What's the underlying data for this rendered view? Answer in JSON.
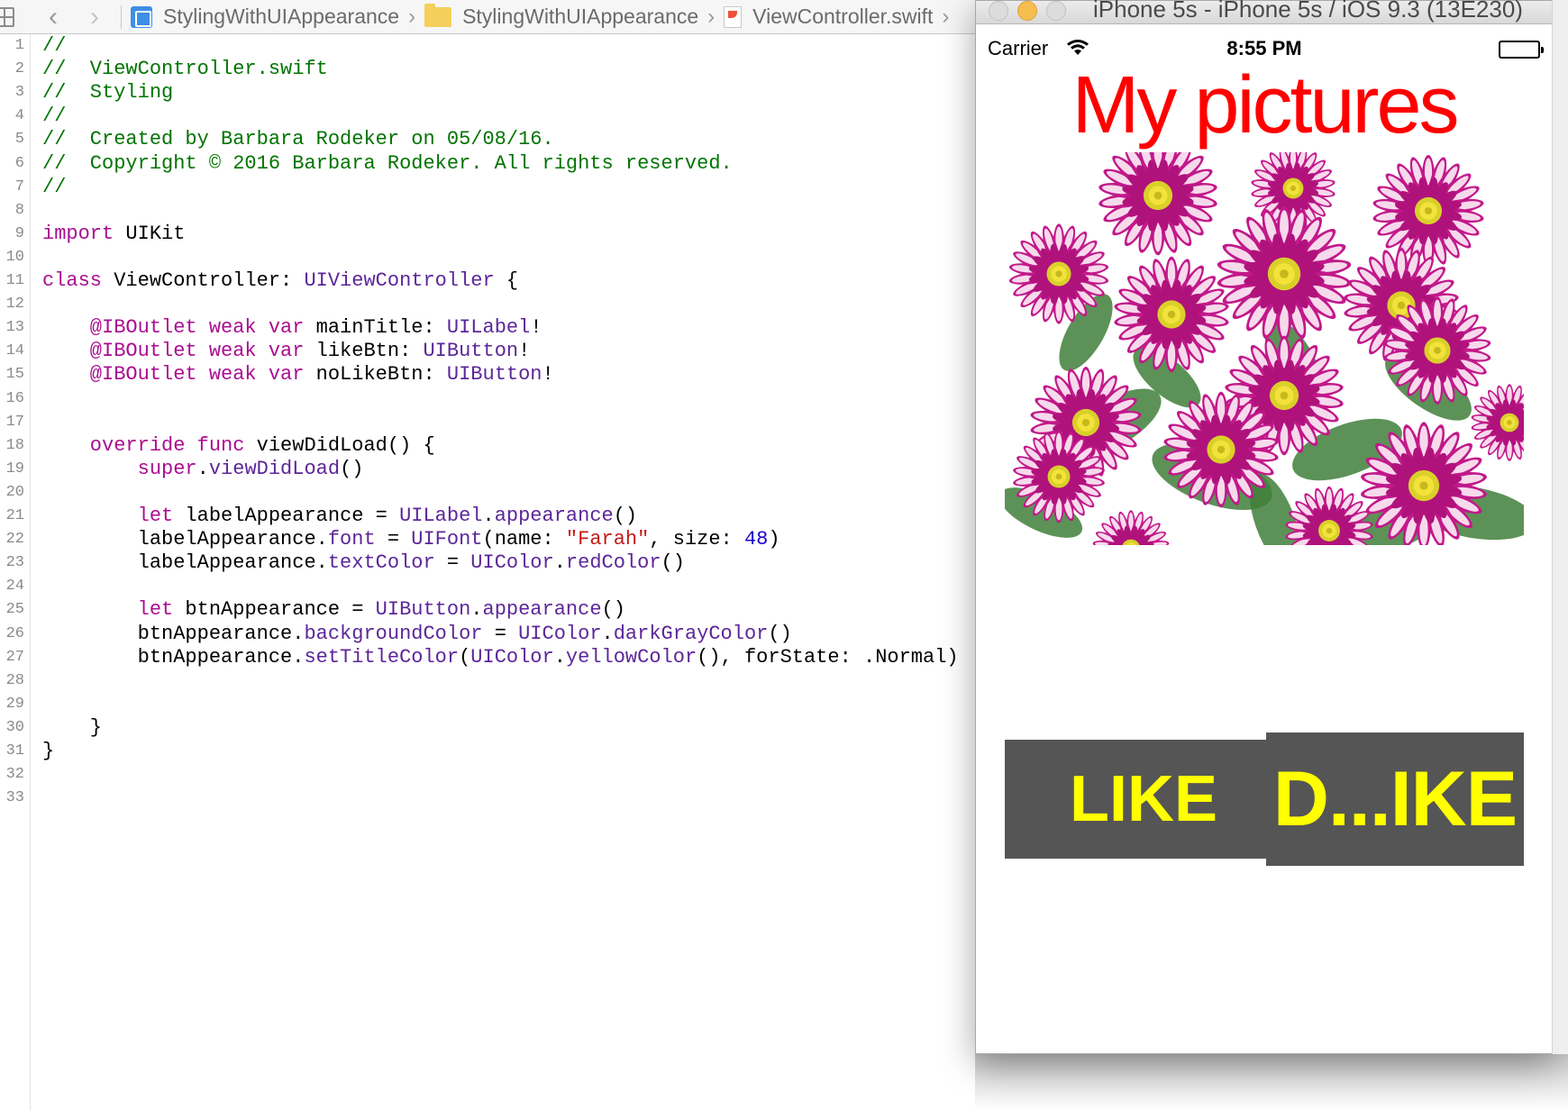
{
  "jumpbar": {
    "crumbs": [
      {
        "label": "StylingWithUIAppearance",
        "icon": "project-icon"
      },
      {
        "label": "StylingWithUIAppearance",
        "icon": "folder-icon"
      },
      {
        "label": "ViewController.swift",
        "icon": "swift-file-icon"
      }
    ]
  },
  "editor": {
    "line_numbers": [
      "1",
      "2",
      "3",
      "4",
      "5",
      "6",
      "7",
      "8",
      "9",
      "10",
      "11",
      "12",
      "13",
      "14",
      "15",
      "16",
      "17",
      "18",
      "19",
      "20",
      "21",
      "22",
      "23",
      "24",
      "25",
      "26",
      "27",
      "28",
      "29",
      "30",
      "31",
      "32",
      "33"
    ],
    "syntax_colors": {
      "comment": "#007400",
      "keyword": "#aa0d91",
      "type": "#5c2699",
      "string": "#c41a16",
      "number": "#1c00cf"
    },
    "lines": [
      [
        {
          "t": "//",
          "c": "comment"
        }
      ],
      [
        {
          "t": "//  ViewController.swift",
          "c": "comment"
        }
      ],
      [
        {
          "t": "//  Styling",
          "c": "comment"
        }
      ],
      [
        {
          "t": "//",
          "c": "comment"
        }
      ],
      [
        {
          "t": "//  Created by Barbara Rodeker on 05/08/16.",
          "c": "comment"
        }
      ],
      [
        {
          "t": "//  Copyright © 2016 Barbara Rodeker. All rights reserved.",
          "c": "comment"
        }
      ],
      [
        {
          "t": "//",
          "c": "comment"
        }
      ],
      [],
      [
        {
          "t": "import",
          "c": "kw"
        },
        {
          "t": " UIKit",
          "c": "plain"
        }
      ],
      [],
      [
        {
          "t": "class",
          "c": "kw"
        },
        {
          "t": " ViewController: ",
          "c": "plain"
        },
        {
          "t": "UIViewController",
          "c": "type"
        },
        {
          "t": " {",
          "c": "plain"
        }
      ],
      [],
      [
        {
          "t": "    @IBOutlet weak var",
          "c": "kw"
        },
        {
          "t": " mainTitle: ",
          "c": "plain"
        },
        {
          "t": "UILabel",
          "c": "type"
        },
        {
          "t": "!",
          "c": "plain"
        }
      ],
      [
        {
          "t": "    @IBOutlet weak var",
          "c": "kw"
        },
        {
          "t": " likeBtn: ",
          "c": "plain"
        },
        {
          "t": "UIButton",
          "c": "type"
        },
        {
          "t": "!",
          "c": "plain"
        }
      ],
      [
        {
          "t": "    @IBOutlet weak var",
          "c": "kw"
        },
        {
          "t": " noLikeBtn: ",
          "c": "plain"
        },
        {
          "t": "UIButton",
          "c": "type"
        },
        {
          "t": "!",
          "c": "plain"
        }
      ],
      [],
      [],
      [
        {
          "t": "    override func",
          "c": "kw"
        },
        {
          "t": " viewDidLoad() {",
          "c": "plain"
        }
      ],
      [
        {
          "t": "        ",
          "c": "plain"
        },
        {
          "t": "super",
          "c": "kw"
        },
        {
          "t": ".",
          "c": "plain"
        },
        {
          "t": "viewDidLoad",
          "c": "type"
        },
        {
          "t": "()",
          "c": "plain"
        }
      ],
      [],
      [
        {
          "t": "        ",
          "c": "plain"
        },
        {
          "t": "let",
          "c": "kw"
        },
        {
          "t": " labelAppearance = ",
          "c": "plain"
        },
        {
          "t": "UILabel",
          "c": "type"
        },
        {
          "t": ".",
          "c": "plain"
        },
        {
          "t": "appearance",
          "c": "type"
        },
        {
          "t": "()",
          "c": "plain"
        }
      ],
      [
        {
          "t": "        labelAppearance.",
          "c": "plain"
        },
        {
          "t": "font",
          "c": "type"
        },
        {
          "t": " = ",
          "c": "plain"
        },
        {
          "t": "UIFont",
          "c": "type"
        },
        {
          "t": "(name: ",
          "c": "plain"
        },
        {
          "t": "\"Farah\"",
          "c": "str"
        },
        {
          "t": ", size: ",
          "c": "plain"
        },
        {
          "t": "48",
          "c": "num"
        },
        {
          "t": ")",
          "c": "plain"
        }
      ],
      [
        {
          "t": "        labelAppearance.",
          "c": "plain"
        },
        {
          "t": "textColor",
          "c": "type"
        },
        {
          "t": " = ",
          "c": "plain"
        },
        {
          "t": "UIColor",
          "c": "type"
        },
        {
          "t": ".",
          "c": "plain"
        },
        {
          "t": "redColor",
          "c": "type"
        },
        {
          "t": "()",
          "c": "plain"
        }
      ],
      [],
      [
        {
          "t": "        ",
          "c": "plain"
        },
        {
          "t": "let",
          "c": "kw"
        },
        {
          "t": " btnAppearance = ",
          "c": "plain"
        },
        {
          "t": "UIButton",
          "c": "type"
        },
        {
          "t": ".",
          "c": "plain"
        },
        {
          "t": "appearance",
          "c": "type"
        },
        {
          "t": "()",
          "c": "plain"
        }
      ],
      [
        {
          "t": "        btnAppearance.",
          "c": "plain"
        },
        {
          "t": "backgroundColor",
          "c": "type"
        },
        {
          "t": " = ",
          "c": "plain"
        },
        {
          "t": "UIColor",
          "c": "type"
        },
        {
          "t": ".",
          "c": "plain"
        },
        {
          "t": "darkGrayColor",
          "c": "type"
        },
        {
          "t": "()",
          "c": "plain"
        }
      ],
      [
        {
          "t": "        btnAppearance.",
          "c": "plain"
        },
        {
          "t": "setTitleColor",
          "c": "type"
        },
        {
          "t": "(",
          "c": "plain"
        },
        {
          "t": "UIColor",
          "c": "type"
        },
        {
          "t": ".",
          "c": "plain"
        },
        {
          "t": "yellowColor",
          "c": "type"
        },
        {
          "t": "(), forState: .Normal)",
          "c": "plain"
        }
      ],
      [],
      [],
      [
        {
          "t": "    }",
          "c": "plain"
        }
      ],
      [
        {
          "t": "}",
          "c": "plain"
        }
      ],
      [],
      []
    ]
  },
  "simulator": {
    "window_title": "iPhone 5s - iPhone 5s / iOS 9.3 (13E230)",
    "status_bar": {
      "carrier": "Carrier",
      "time": "8:55 PM"
    },
    "main_title": "My pictures",
    "like_button": "LIKE",
    "dislike_button": "D...IKE",
    "colors": {
      "title": "#ff0000",
      "button_bg": "#555555",
      "button_text": "#ffff00"
    }
  }
}
